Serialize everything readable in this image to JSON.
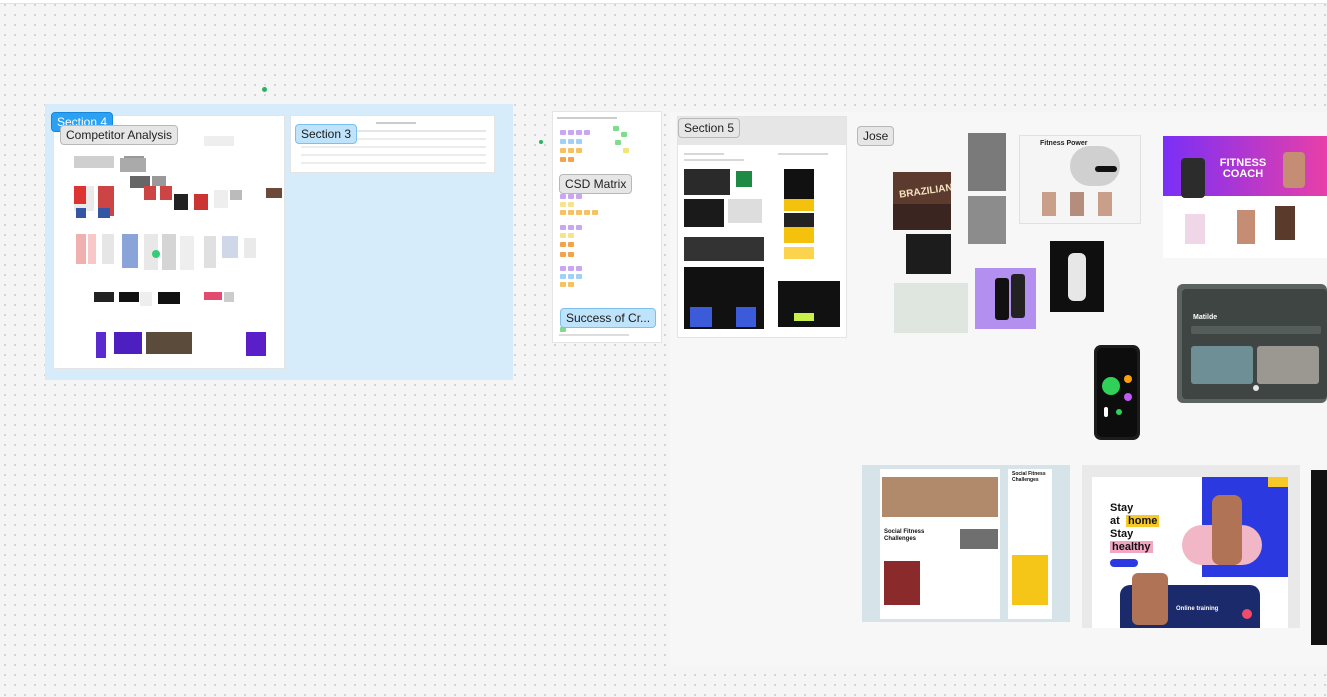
{
  "canvas": {
    "sections": {
      "section4": {
        "label": "Section 4",
        "title": "Competitor Analysis"
      },
      "section3": {
        "label": "Section 3"
      },
      "csd": {
        "label": "CSD Matrix",
        "sub_label": "Success of Cr..."
      },
      "section5": {
        "label": "Section 5"
      },
      "jose": {
        "label": "Jose"
      }
    },
    "mockups": {
      "fitness_power": "Fitness Power",
      "fitness_coach": "FITNESS COACH",
      "mobile_name": "Matilde",
      "social_title": "Social Fitness Challenges",
      "social_title_2": "Social Fitness Challenges",
      "stay_line1": "Stay",
      "stay_line2a": "at",
      "stay_line2b": "home",
      "stay_line3": "Stay",
      "stay_line4": "healthy",
      "online_training": "Online training",
      "brazilian": "BRAZILIAN"
    },
    "colors": {
      "section_bg": "#d6ecfb",
      "active_tag": "#2aa1f3",
      "coach_purple": "#7a2ff7",
      "coach_pink": "#e83fa8",
      "stay_blue": "#2b39e0",
      "stay_yellow": "#f6c928",
      "online_navy": "#1b2a6b"
    }
  }
}
